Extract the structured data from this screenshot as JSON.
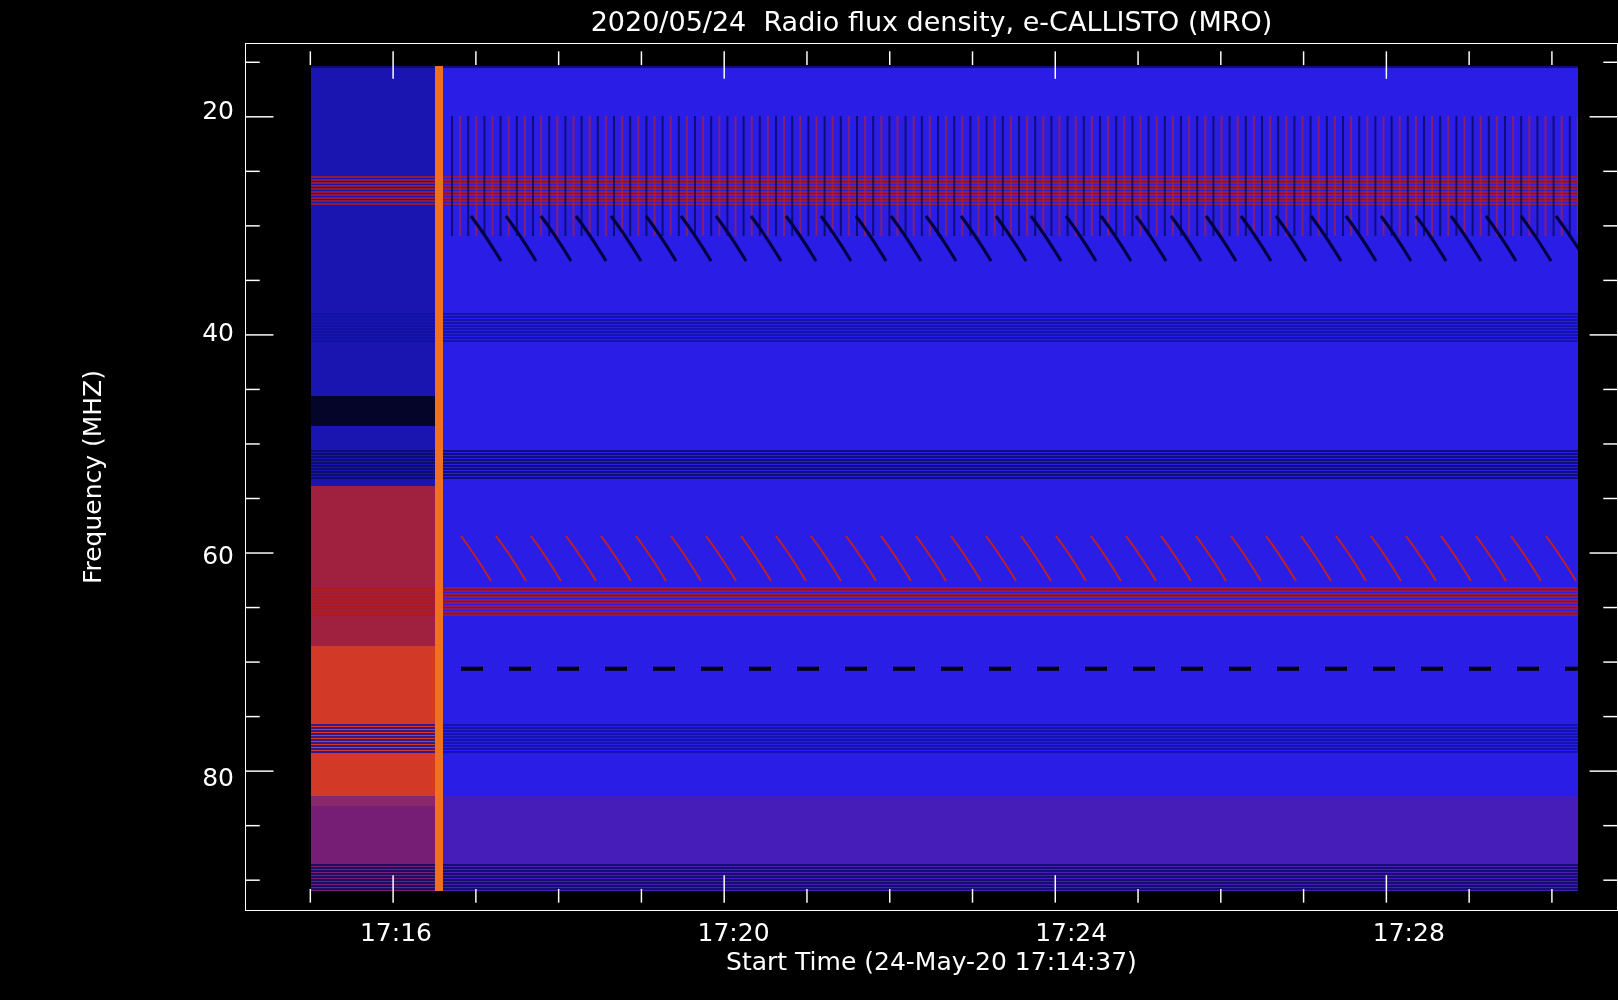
{
  "title": "2020/05/24  Radio flux density, e-CALLISTO (MRO)",
  "y_axis": {
    "label": "Frequency (MHZ)",
    "ticks": [
      "20",
      "40",
      "60",
      "80"
    ]
  },
  "x_axis": {
    "label": "Start Time (24-May-20 17:14:37)",
    "ticks": [
      "17:16",
      "17:20",
      "17:24",
      "17:28"
    ]
  }
}
